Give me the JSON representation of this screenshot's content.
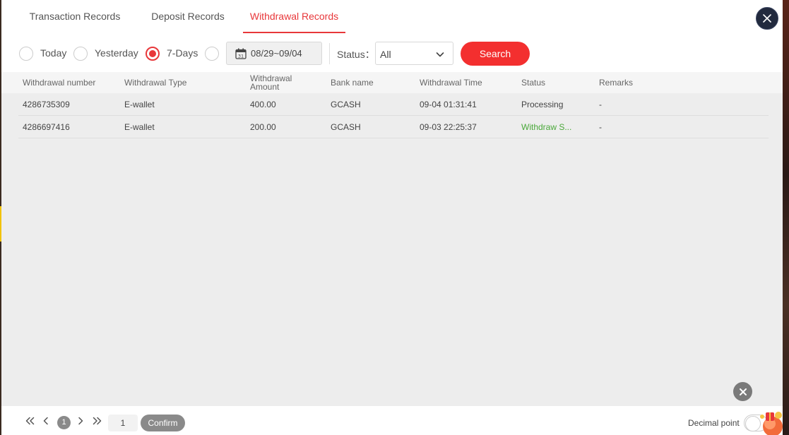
{
  "tabs": [
    {
      "label": "Transaction Records",
      "active": false
    },
    {
      "label": "Deposit Records",
      "active": false
    },
    {
      "label": "Withdrawal Records",
      "active": true
    }
  ],
  "filters": {
    "ranges": [
      {
        "label": "Today",
        "checked": false
      },
      {
        "label": "Yesterday",
        "checked": false
      },
      {
        "label": "7-Days",
        "checked": true
      },
      {
        "label": "",
        "checked": false
      }
    ],
    "date_range": "08/29~09/04",
    "calendar_day": "31",
    "status_label": "Status：",
    "status_value": "All",
    "search_label": "Search"
  },
  "table": {
    "headers": {
      "number": "Withdrawal number",
      "type": "Withdrawal Type",
      "amount_line1": "Withdrawal",
      "amount_line2": "Amount",
      "bank": "Bank name",
      "time": "Withdrawal Time",
      "status": "Status",
      "remarks": "Remarks"
    },
    "rows": [
      {
        "number": "4286735309",
        "type": "E-wallet",
        "amount": "400.00",
        "bank": "GCASH",
        "time": "09-04 01:31:41",
        "status": "Processing",
        "status_color": "#444444",
        "remarks": "-"
      },
      {
        "number": "4286697416",
        "type": "E-wallet",
        "amount": "200.00",
        "bank": "GCASH",
        "time": "09-03 22:25:37",
        "status": "Withdraw S...",
        "status_color": "#4aa83a",
        "remarks": "-"
      }
    ]
  },
  "pagination": {
    "current_page": "1",
    "page_input": "1",
    "confirm_label": "Confirm"
  },
  "footer": {
    "decimal_label": "Decimal point"
  },
  "colors": {
    "accent": "#e8373a",
    "search_button": "#f32f2f",
    "success": "#4aa83a"
  }
}
